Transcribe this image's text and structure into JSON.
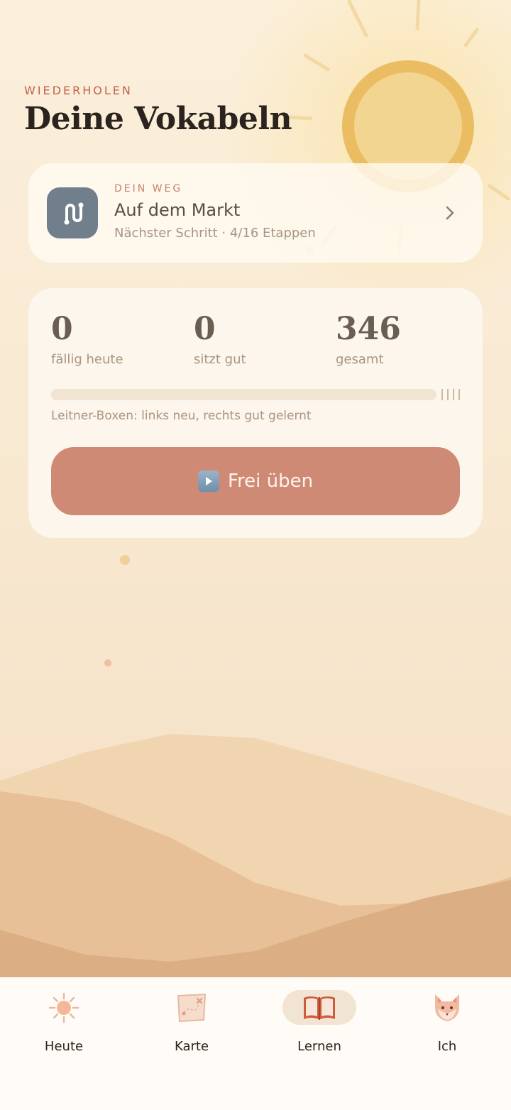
{
  "header": {
    "eyebrow": "WIEDERHOLEN",
    "title": "Deine Vokabeln"
  },
  "path_card": {
    "eyebrow": "DEIN WEG",
    "title": "Auf dem Markt",
    "subtitle": "Nächster Schritt · 4/16 Etappen",
    "icon": "route-icon",
    "icon_color": "#717f8c"
  },
  "stats": {
    "items": [
      {
        "value": "0",
        "label": "fällig heute"
      },
      {
        "value": "0",
        "label": "sitzt gut"
      },
      {
        "value": "346",
        "label": "gesamt"
      }
    ],
    "legend": "Leitner-Boxen: links neu, rechts gut gelernt",
    "practice_label": "Frei üben",
    "practice_icon": "play-icon",
    "accent_color": "#cf8a75"
  },
  "tabs": [
    {
      "label": "Heute",
      "icon": "sun-icon",
      "active": false
    },
    {
      "label": "Karte",
      "icon": "map-icon",
      "active": false
    },
    {
      "label": "Lernen",
      "icon": "book-icon",
      "active": true
    },
    {
      "label": "Ich",
      "icon": "fox-icon",
      "active": false
    }
  ]
}
